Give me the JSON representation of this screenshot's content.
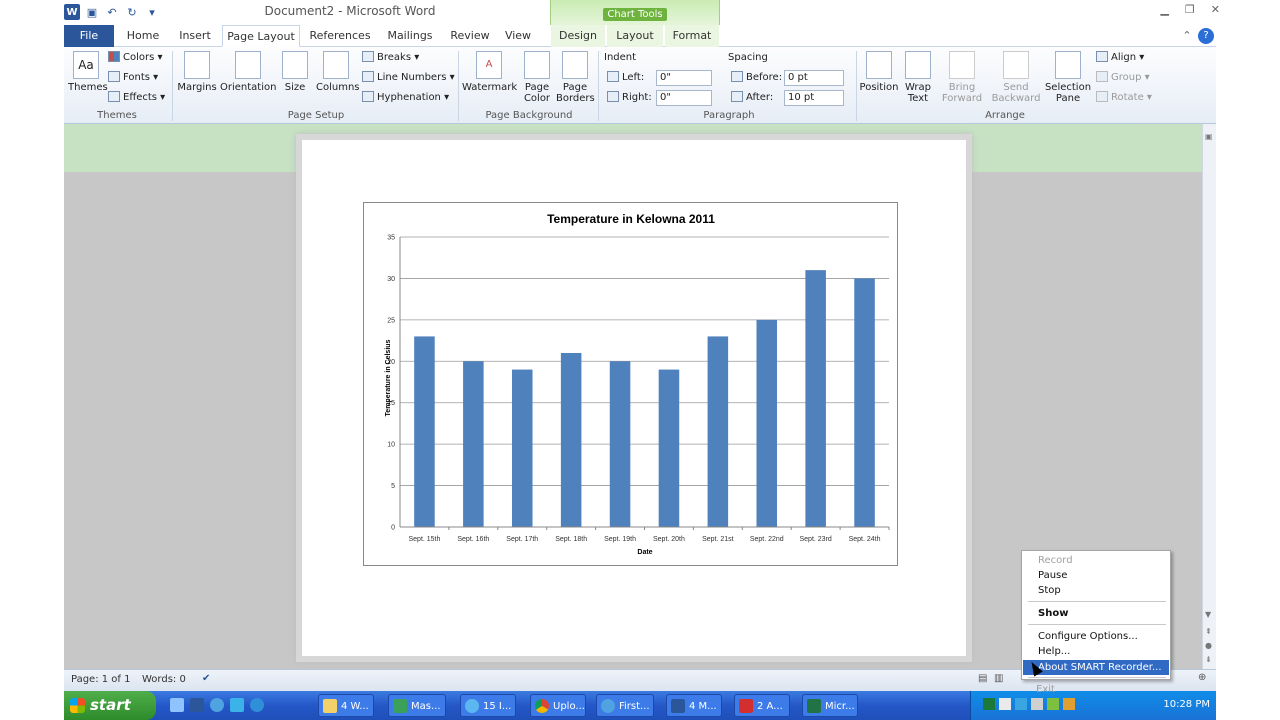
{
  "window": {
    "title": "Document2 - Microsoft Word",
    "contextual_tab_group": "Chart Tools"
  },
  "qat": {
    "icons": [
      "word-icon",
      "save-icon",
      "undo-icon",
      "redo-icon",
      "customize-icon"
    ]
  },
  "tabs": [
    "File",
    "Home",
    "Insert",
    "Page Layout",
    "References",
    "Mailings",
    "Review",
    "View",
    "Design",
    "Layout",
    "Format"
  ],
  "active_tab": "Page Layout",
  "ribbon": {
    "themes": {
      "themes": "Themes",
      "colors": "Colors",
      "fonts": "Fonts",
      "effects": "Effects",
      "group": "Themes"
    },
    "page_setup": {
      "margins": "Margins",
      "orientation": "Orientation",
      "size": "Size",
      "columns": "Columns",
      "breaks": "Breaks",
      "line_numbers": "Line Numbers",
      "hyphenation": "Hyphenation",
      "group": "Page Setup"
    },
    "page_background": {
      "watermark": "Watermark",
      "page_color": "Page Color",
      "page_borders": "Page Borders",
      "group": "Page Background"
    },
    "paragraph": {
      "indent": "Indent",
      "left": "Left:",
      "left_value": "0\"",
      "right": "Right:",
      "right_value": "0\"",
      "spacing": "Spacing",
      "before": "Before:",
      "before_value": "0 pt",
      "after": "After:",
      "after_value": "10 pt",
      "group": "Paragraph"
    },
    "arrange": {
      "position": "Position",
      "wrap_text": "Wrap Text",
      "bring_forward": "Bring Forward",
      "send_backward": "Send Backward",
      "selection_pane": "Selection Pane",
      "align": "Align",
      "group_btn": "Group",
      "rotate": "Rotate",
      "group": "Arrange"
    }
  },
  "status": {
    "page": "Page: 1 of 1",
    "words": "Words: 0"
  },
  "taskbar": {
    "start": "start",
    "items": [
      "4 W...",
      "Mas...",
      "15 I...",
      "Uplo...",
      "First...",
      "4 M...",
      "2 A...",
      "Micr..."
    ],
    "clock": "10:28 PM"
  },
  "context_menu": {
    "items": [
      "Record",
      "Pause",
      "Stop",
      "Show",
      "Configure Options...",
      "Help...",
      "About SMART Recorder...",
      "Exit"
    ]
  },
  "chart_data": {
    "type": "bar",
    "title": "Temperature in Kelowna 2011",
    "xlabel": "Date",
    "ylabel": "Temperature in Celsius",
    "categories": [
      "Sept. 15th",
      "Sept. 16th",
      "Sept. 17th",
      "Sept. 18th",
      "Sept. 19th",
      "Sept. 20th",
      "Sept. 21st",
      "Sept. 22nd",
      "Sept. 23rd",
      "Sept. 24th"
    ],
    "values": [
      23,
      20,
      19,
      21,
      20,
      19,
      23,
      25,
      31,
      30
    ],
    "ylim": [
      0,
      35
    ],
    "yticks": [
      0,
      5,
      10,
      15,
      20,
      25,
      30,
      35
    ],
    "grid": true,
    "bar_color": "#4f81bd"
  }
}
